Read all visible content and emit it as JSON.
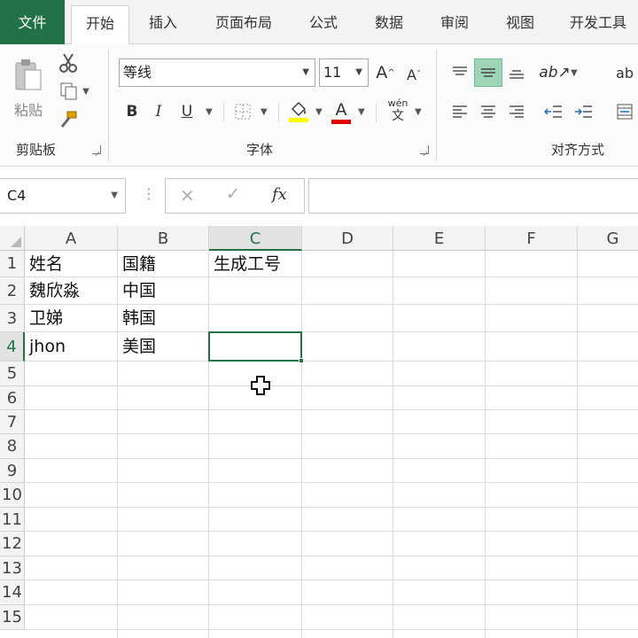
{
  "tabs": {
    "file": "文件",
    "home": "开始",
    "insert": "插入",
    "page_layout": "页面布局",
    "formulas": "公式",
    "data": "数据",
    "review": "审阅",
    "view": "视图",
    "developer": "开发工具"
  },
  "ribbon": {
    "clipboard": {
      "paste_label": "粘贴",
      "group_label": "剪贴板"
    },
    "font": {
      "font_name": "等线",
      "font_size": "11",
      "grow_label": "A",
      "shrink_label": "A",
      "bold_label": "B",
      "italic_label": "I",
      "underline_label": "U",
      "fill_letter": "A",
      "phonetic_top": "wén",
      "phonetic_bottom": "文",
      "group_label": "字体"
    },
    "alignment": {
      "wrap_label": "ab",
      "group_label": "对齐方式"
    }
  },
  "formula_bar": {
    "name_box": "C4",
    "cancel_icon": "×",
    "enter_icon": "✓",
    "fx_label": "fx",
    "formula": ""
  },
  "sheet": {
    "columns": [
      "A",
      "B",
      "C",
      "D",
      "E",
      "F",
      "G"
    ],
    "rows": [
      "1",
      "2",
      "3",
      "4",
      "5",
      "6",
      "7",
      "8",
      "9",
      "10",
      "11",
      "12",
      "13",
      "14",
      "15"
    ],
    "cells": {
      "A1": "姓名",
      "B1": "国籍",
      "C1": "生成工号",
      "A2": "魏欣淼",
      "B2": "中国",
      "A3": "卫娣",
      "B3": "韩国",
      "A4": "jhon",
      "B4": "美国"
    },
    "active_cell": "C4"
  },
  "colors": {
    "accent": "#217346",
    "font_color": "#e00000",
    "fill_color": "#ffff00"
  }
}
